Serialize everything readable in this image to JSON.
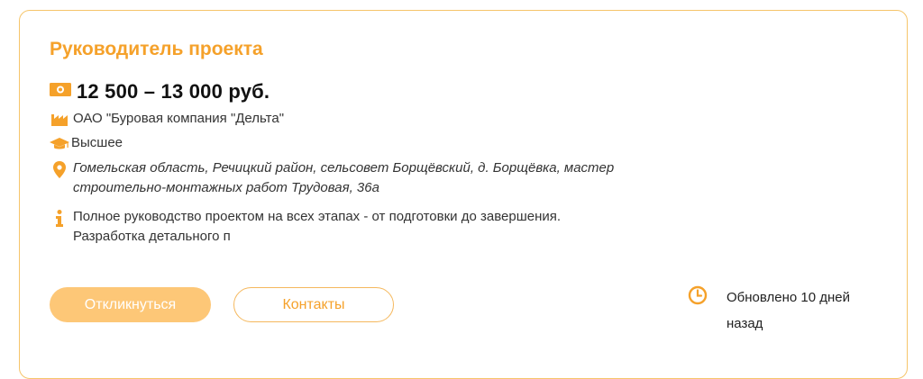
{
  "vacancy": {
    "title": "Руководитель проекта",
    "salary": "12 500 – 13 000 руб.",
    "company": "ОАО \"Буровая компания \"Дельта\"",
    "education": "Высшее",
    "location": "Гомельская область, Речицкий район, сельсовет Борщёвский, д. Борщёвка, мастер строительно-монтажных работ Трудовая, 36а",
    "description": "Полное руководство проектом на всех этапах - от подготовки до завершения. Разработка детального п"
  },
  "actions": {
    "respond_label": "Откликнуться",
    "contacts_label": "Контакты"
  },
  "meta": {
    "updated": "Обновлено 10 дней назад"
  },
  "icons": {
    "salary": "money-icon",
    "company": "factory-icon",
    "education": "graduation-cap-icon",
    "location": "location-pin-icon",
    "description": "info-icon",
    "updated": "clock-icon"
  },
  "colors": {
    "accent": "#f5a12a",
    "button_fill": "#fdc777",
    "card_border": "#f6c56a"
  }
}
